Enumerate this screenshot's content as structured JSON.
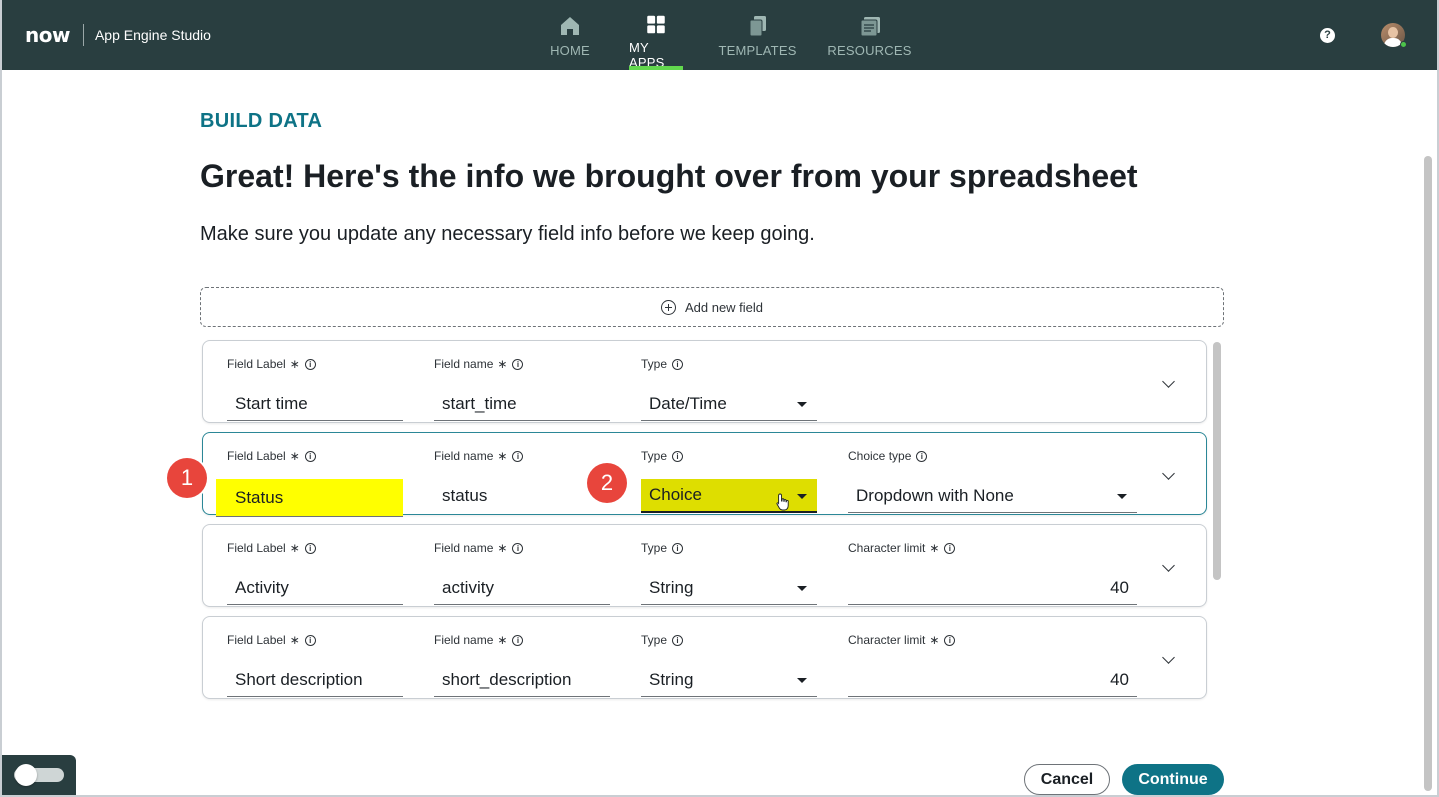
{
  "header": {
    "logo": "now",
    "app_name": "App Engine Studio",
    "nav": [
      {
        "label": "HOME",
        "icon": "home-icon",
        "active": false
      },
      {
        "label": "MY APPS",
        "icon": "grid-icon",
        "active": true
      },
      {
        "label": "TEMPLATES",
        "icon": "templates-icon",
        "active": false
      },
      {
        "label": "RESOURCES",
        "icon": "resources-icon",
        "active": false
      }
    ],
    "help": "?"
  },
  "page": {
    "section_title": "BUILD DATA",
    "headline": "Great! Here's the info we brought over from your spreadsheet",
    "subtext": "Make sure you update any necessary field info before we keep going.",
    "add_field": "Add new field"
  },
  "labels": {
    "field_label": "Field Label",
    "field_name": "Field name",
    "type": "Type",
    "choice_type": "Choice type",
    "char_limit": "Character limit",
    "required": "∗",
    "info": "i"
  },
  "fields": [
    {
      "label": "Start time",
      "name": "start_time",
      "type": "Date/Time"
    },
    {
      "label": "Status",
      "name": "status",
      "type": "Choice",
      "choice_type": "Dropdown with None"
    },
    {
      "label": "Activity",
      "name": "activity",
      "type": "String",
      "char_limit": "40"
    },
    {
      "label": "Short description",
      "name": "short_description",
      "type": "String",
      "char_limit": "40"
    }
  ],
  "annotations": [
    "1",
    "2"
  ],
  "buttons": {
    "cancel": "Cancel",
    "continue": "Continue"
  },
  "colors": {
    "header_bg": "#293e40",
    "accent": "#0e7386",
    "nav_active": "#62d84e",
    "highlight": "#ffff00",
    "badge": "#e8453c"
  }
}
